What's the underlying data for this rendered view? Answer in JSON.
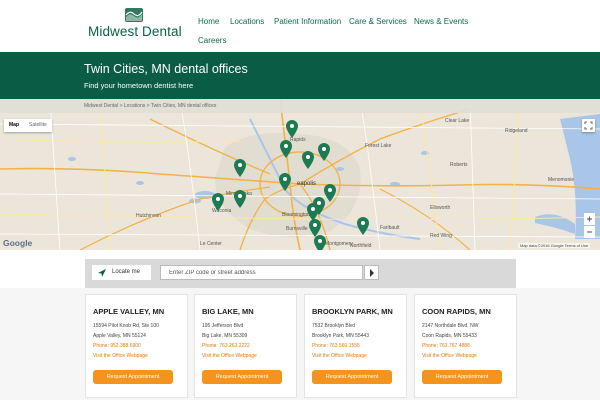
{
  "header": {
    "logo_text": "Midwest Dental",
    "nav": [
      {
        "label": "Home"
      },
      {
        "label": "Locations"
      },
      {
        "label": "Patient Information"
      },
      {
        "label": "Care & Services"
      },
      {
        "label": "News & Events"
      },
      {
        "label": "Careers"
      }
    ]
  },
  "banner": {
    "title": "Twin Cities, MN dental offices",
    "subtitle": "Find your hometown dentist here"
  },
  "map": {
    "breadcrumb": "Midwest Dental > Locations > Twin Cities, MN dental offices",
    "map_type_options": [
      "Map",
      "Satellite"
    ],
    "selected_map_type": "Map",
    "provider": "Google",
    "attribution": "Map data ©2016 Google   Terms of Use",
    "cities": [
      "Rapids",
      "eapolis",
      "Minnetonka",
      "Bloomington",
      "Burnsville",
      "Waconia",
      "Hutchinson",
      "Clear Lake",
      "Forest Lake",
      "Ridgeland",
      "Roberts",
      "Menomonie",
      "Ellsworth",
      "Red Wing",
      "Northfield",
      "Faribault",
      "Le Center",
      "Montgomery"
    ],
    "pin_color": "#1e7a52",
    "pin_count": 14
  },
  "search": {
    "locate_label": "Locate me",
    "placeholder": "Enter ZIP code or street address"
  },
  "offices": [
    {
      "name": "APPLE VALLEY, MN",
      "address1": "15594 Pilot Knob Rd, Ste 100",
      "address2": "Apple Valley, MN 55124",
      "phone": "Phone: 952.388.6900",
      "link": "Visit the Office Webpage",
      "button": "Request Appointment"
    },
    {
      "name": "BIG LAKE, MN",
      "address1": "195 Jefferson Blvd",
      "address2": "Big Lake, MN 55309",
      "phone": "Phone: 763.263.2222",
      "link": "Visit the Office Webpage",
      "button": "Request Appointment"
    },
    {
      "name": "BROOKLYN PARK, MN",
      "address1": "7532 Brooklyn Blvd",
      "address2": "Brooklyn Park, MN 55443",
      "phone": "Phone: 763.560.1555",
      "link": "Visit the Office Webpage",
      "button": "Request Appointment"
    },
    {
      "name": "COON RAPIDS, MN",
      "address1": "2147 Northdale Blvd. NW",
      "address2": "Coon Rapids, MN 55433",
      "phone": "Phone: 763.767.4888",
      "link": "Visit the Office Webpage",
      "button": "Request Appointment"
    }
  ],
  "colors": {
    "brand_green": "#0a5c44",
    "accent_orange": "#f4941c"
  }
}
